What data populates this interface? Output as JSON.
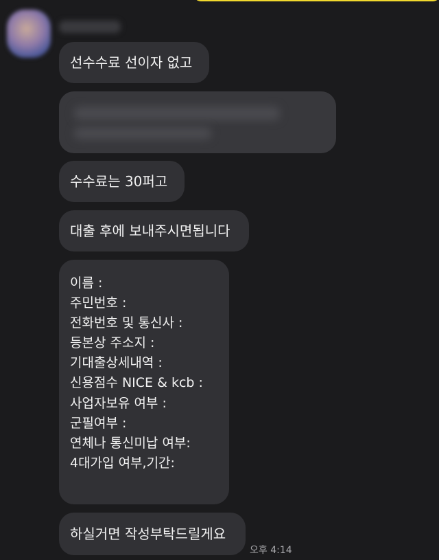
{
  "messages": {
    "m1": "선수수료 선이자 없고",
    "m3": "수수료는 30퍼고",
    "m4": "대출 후에 보내주시면됩니다",
    "form_lines": [
      "이름 :",
      "주민번호 :",
      "전화번호 및 통신사 :",
      "등본상 주소지 :",
      "기대출상세내역 :",
      "신용점수 NICE & kcb :",
      "사업자보유 여부 :",
      "군필여부 :",
      "연체나 통신미납 여부:",
      "4대가입 여부,기간:"
    ],
    "m6": "하실거면 작성부탁드릴게요",
    "time": "오후 4:14"
  },
  "colors": {
    "background": "#1b1b1d",
    "incoming_bubble": "#313135",
    "outgoing_bubble": "#f2d92e",
    "text": "#f2f2f2",
    "timestamp": "#a8a8ac"
  },
  "icons": {
    "avatar": "blurred-profile-avatar"
  }
}
